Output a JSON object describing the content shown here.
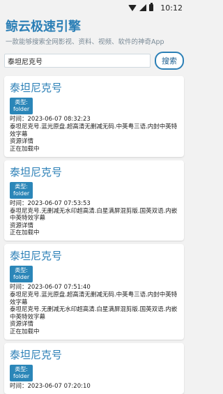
{
  "status_bar": {
    "time": "10:12"
  },
  "header": {
    "title": "鲸云极速引擎",
    "subtitle": "一款能够搜索全网影视、资料、视频、软件的神奇App"
  },
  "search": {
    "value": "泰坦尼克号",
    "button_label": "搜索"
  },
  "results": [
    {
      "title": "泰坦尼克号",
      "type_label": "类型:",
      "type_value": "folder",
      "time": "时间：2023-06-07 08:32:23",
      "desc1": "泰坦尼克号.蓝光原盘.超高清无删减无码.中英粤三语.内封中英特效字幕",
      "desc2": "资源详情",
      "status": "正在加载中"
    },
    {
      "title": "泰坦尼克号",
      "type_label": "类型:",
      "type_value": "folder",
      "time": "时间：2023-06-07 07:53:53",
      "desc1": "泰坦尼克号.无删减无水印超高清.白星满屏混剪版.国英双语.内嵌中英特效字幕",
      "desc2": "资源详情",
      "status": "正在加载中"
    },
    {
      "title": "泰坦尼克号",
      "type_label": "类型:",
      "type_value": "folder",
      "time": "时间：2023-06-07 07:51:40",
      "desc1": "泰坦尼克号.蓝光原盘.超高清无删减无码.中英粤三语.内封中英特效字幕",
      "desc1b": "泰坦尼克号.无删减无水印超高清.白星满屏混剪版.国英双语.内嵌中英特效字幕",
      "desc2": "资源详情",
      "status": "正在加载中"
    },
    {
      "title": "泰坦尼克号",
      "type_label": "类型:",
      "type_value": "folder",
      "time": "时间：2023-06-07 07:20:10"
    }
  ]
}
